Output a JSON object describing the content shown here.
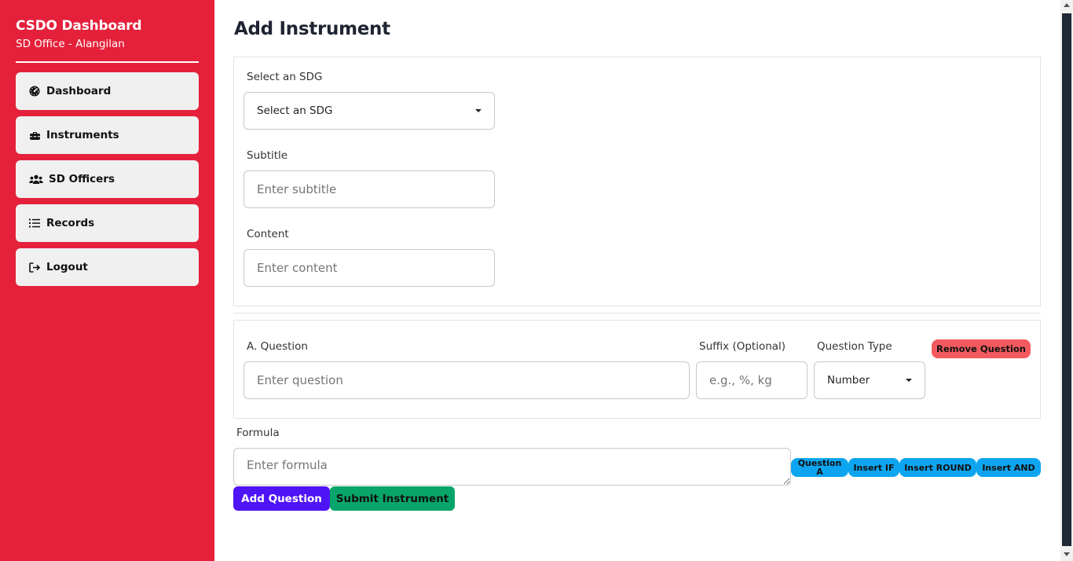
{
  "sidebar": {
    "brand_title": "CSDO Dashboard",
    "brand_subtitle": "SD Office - Alangilan",
    "items": [
      {
        "label": "Dashboard",
        "icon": "gauge-icon"
      },
      {
        "label": "Instruments",
        "icon": "toolbox-icon"
      },
      {
        "label": "SD Officers",
        "icon": "users-icon"
      },
      {
        "label": "Records",
        "icon": "list-icon"
      },
      {
        "label": "Logout",
        "icon": "logout-icon"
      }
    ],
    "bg_color": "#e5203a"
  },
  "main": {
    "title": "Add Instrument",
    "sdg": {
      "label": "Select an SDG",
      "selected": "Select an SDG"
    },
    "subtitle": {
      "label": "Subtitle",
      "placeholder": "Enter subtitle"
    },
    "content": {
      "label": "Content",
      "placeholder": "Enter content"
    },
    "question": {
      "label": "A. Question",
      "placeholder": "Enter question",
      "suffix_label": "Suffix (Optional)",
      "suffix_placeholder": "e.g., %, kg",
      "type_label": "Question Type",
      "type_selected": "Number",
      "remove_label": "Remove Question"
    },
    "formula": {
      "label": "Formula",
      "placeholder": "Enter formula",
      "chips": [
        "Question A",
        "Insert IF",
        "Insert ROUND",
        "Insert AND"
      ]
    },
    "add_question_label": "Add Question",
    "submit_label": "Submit Instrument"
  },
  "colors": {
    "remove": "#f25a5f",
    "chip": "#0ea5f0",
    "add": "#4f14f5",
    "submit": "#07a56a"
  }
}
